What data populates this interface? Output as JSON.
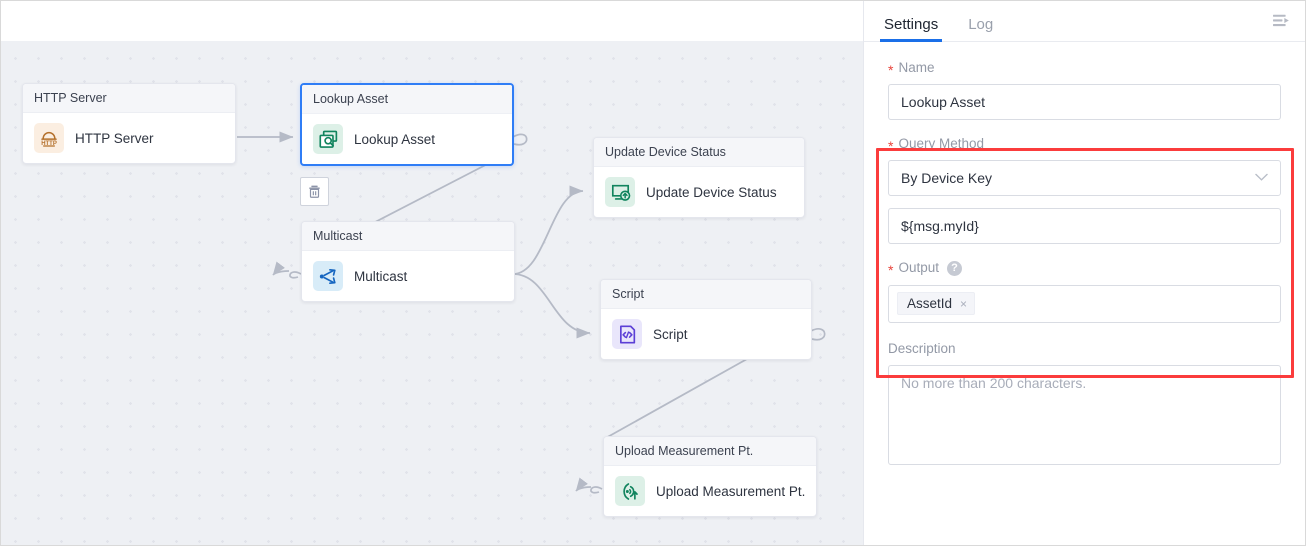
{
  "canvas": {
    "nodes": [
      {
        "id": "http-server",
        "title": "HTTP Server",
        "label": "HTTP Server",
        "icon": "http-server-icon",
        "selected": false
      },
      {
        "id": "lookup-asset",
        "title": "Lookup Asset",
        "label": "Lookup Asset",
        "icon": "lookup-asset-icon",
        "selected": true
      },
      {
        "id": "multicast",
        "title": "Multicast",
        "label": "Multicast",
        "icon": "multicast-icon",
        "selected": false
      },
      {
        "id": "update-device",
        "title": "Update Device Status",
        "label": "Update Device Status",
        "icon": "update-device-status-icon",
        "selected": false
      },
      {
        "id": "script",
        "title": "Script",
        "label": "Script",
        "icon": "script-icon",
        "selected": false
      },
      {
        "id": "upload-meas",
        "title": "Upload Measurement Pt.",
        "label": "Upload Measurement Pt.",
        "icon": "upload-measurement-icon",
        "selected": false
      }
    ],
    "delete_button_title": "Delete"
  },
  "panel": {
    "tabs": [
      {
        "id": "settings",
        "label": "Settings",
        "active": true
      },
      {
        "id": "log",
        "label": "Log",
        "active": false
      }
    ],
    "menu_icon": "panel-collapse-icon",
    "fields": {
      "name": {
        "label": "Name",
        "required": true,
        "value": "Lookup Asset"
      },
      "query_method": {
        "label": "Query Method",
        "required": true,
        "value": "By Device Key",
        "chevron": "⌄",
        "options": [
          "By Device Key"
        ]
      },
      "query_value": {
        "value": "${msg.myId}"
      },
      "output": {
        "label": "Output",
        "required": true,
        "help": "?",
        "tags": [
          "AssetId"
        ],
        "tag_remove": "×"
      },
      "description": {
        "label": "Description",
        "required": false,
        "value": "",
        "placeholder": "No more than 200 characters."
      }
    },
    "highlight_color": "#fb3c3c"
  },
  "colors": {
    "accent": "#1a6fe8",
    "required": "#e8443c",
    "canvas_bg": "#eef0f4",
    "node_border_selected": "#2f7df6",
    "edge": "#b5bac6"
  }
}
